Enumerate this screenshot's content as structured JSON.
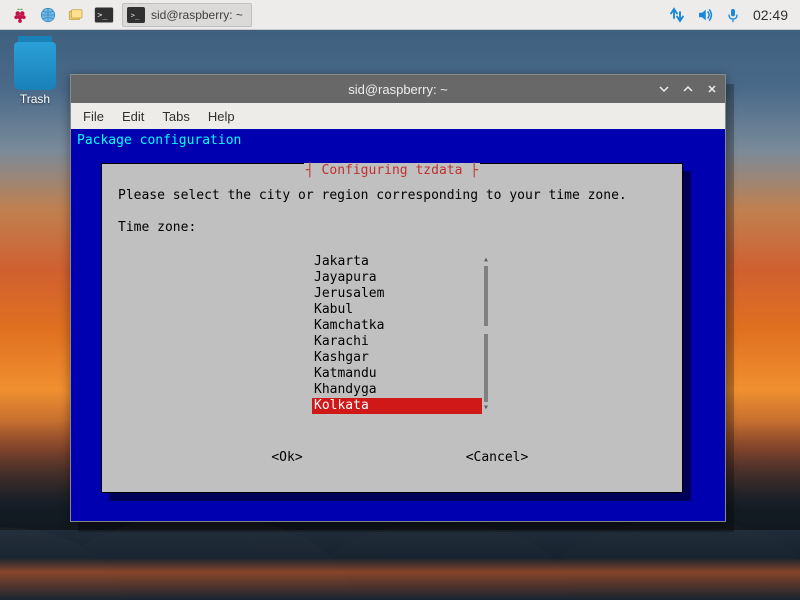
{
  "taskbar": {
    "task": {
      "label": "sid@raspberry: ~"
    },
    "clock": "02:49"
  },
  "desktop": {
    "trash_label": "Trash"
  },
  "terminal": {
    "title": "sid@raspberry: ~",
    "menubar": [
      "File",
      "Edit",
      "Tabs",
      "Help"
    ],
    "header_line": "Package configuration",
    "dialog": {
      "title_left": "┤",
      "title": " Configuring tzdata ",
      "title_right": "├",
      "prompt": "Please select the city or region corresponding to your time zone.",
      "field_label": "Time zone:",
      "items": [
        "Jakarta",
        "Jayapura",
        "Jerusalem",
        "Kabul",
        "Kamchatka",
        "Karachi",
        "Kashgar",
        "Katmandu",
        "Khandyga",
        "Kolkata"
      ],
      "selected_index": 9,
      "ok_label": "<Ok>",
      "cancel_label": "<Cancel>"
    }
  }
}
